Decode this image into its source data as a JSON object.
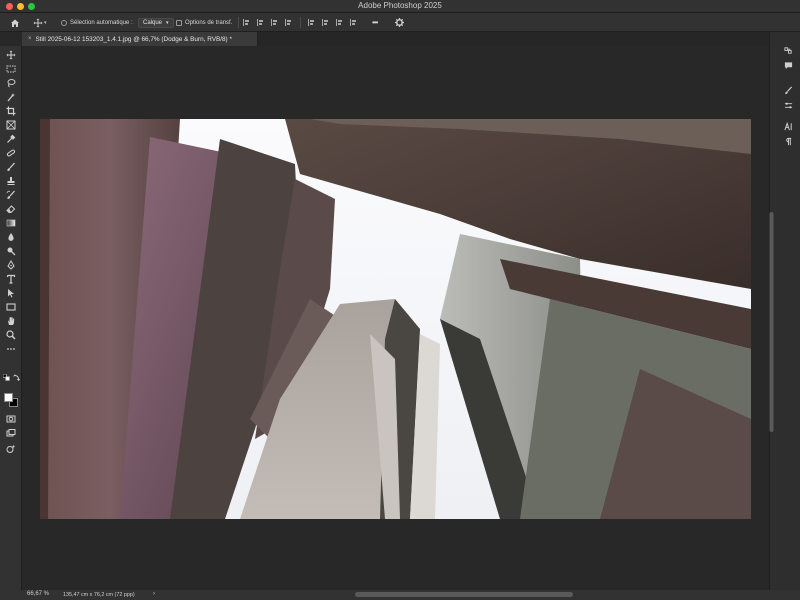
{
  "app": {
    "title": "Adobe Photoshop 2025"
  },
  "options_bar": {
    "auto_select_label": "Sélection automatique :",
    "auto_select_value": "Calque",
    "transform_label": "Options de transf.",
    "more_label": "•••"
  },
  "document": {
    "tab_title": "Still 2025-06-12 153203_1.4.1.jpg @ 66,7% (Dodge & Burn, RVB/8) *",
    "close_glyph": "×"
  },
  "status": {
    "zoom": "66,67 %",
    "dimensions": "135,47 cm x 76,2 cm (72 ppp)",
    "chevron": "›"
  },
  "colors": {
    "foreground": "#ffffff",
    "background": "#000000",
    "chrome": "#323232",
    "canvas": "#282828"
  },
  "tools": [
    "move-tool-icon",
    "marquee-tool-icon",
    "lasso-tool-icon",
    "object-select-tool-icon",
    "crop-tool-icon",
    "frame-tool-icon",
    "eyedropper-tool-icon",
    "healing-brush-icon",
    "brush-tool-icon",
    "clone-stamp-icon",
    "history-brush-icon",
    "eraser-tool-icon",
    "gradient-tool-icon",
    "blur-tool-icon",
    "dodge-tool-icon",
    "pen-tool-icon",
    "type-tool-icon",
    "path-select-icon",
    "rectangle-tool-icon",
    "hand-tool-icon",
    "zoom-tool-icon",
    "more-tools-icon"
  ],
  "right_dock": [
    "history-panel-icon",
    "comments-icon",
    "brush-settings-icon",
    "adjustments-icon",
    "character-panel-icon",
    "paragraph-panel-icon"
  ]
}
